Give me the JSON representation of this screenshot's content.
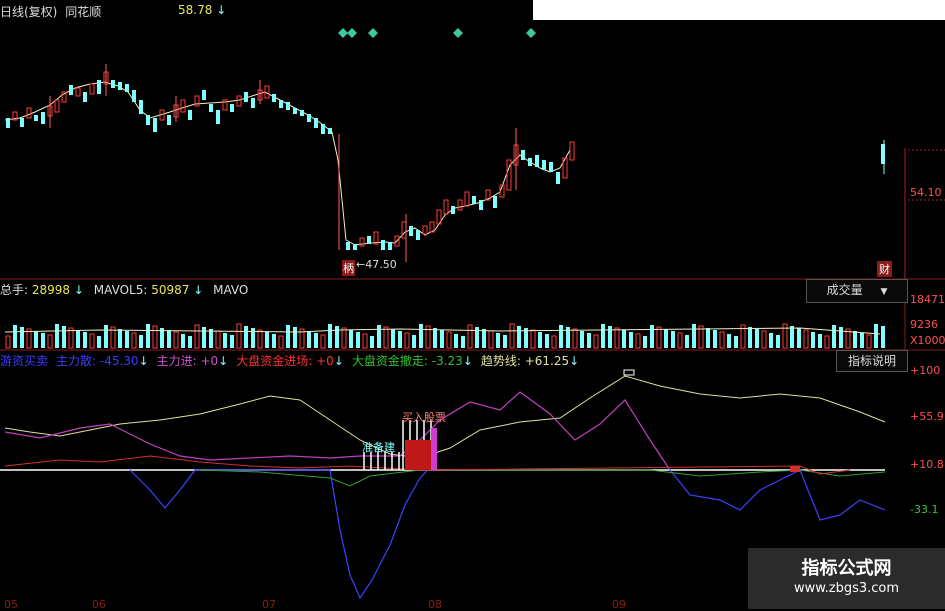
{
  "header": {
    "chart_title": "日线(复权)",
    "stock_name": "同花顺",
    "price_value": "58.78",
    "down_arrow": "↓"
  },
  "price_panel": {
    "right_label": "54.10",
    "low_marker_prefix": "柄",
    "low_marker_text": "←47.50",
    "corner_tag": "财"
  },
  "volume_panel": {
    "total_label": "总手:",
    "total_value": "28998",
    "mavol5_label": "MAVOL5:",
    "mavol5_value": "50987",
    "mavol_tail": "MAVO",
    "dropdown_label": "成交量",
    "axis": [
      "18471",
      "9236",
      "X1000"
    ]
  },
  "indicator_panel": {
    "items": [
      {
        "label": "游资买卖",
        "value": "",
        "color": "#3b3bff"
      },
      {
        "label": "主力散:",
        "value": "-45.30",
        "color": "#3b3bff"
      },
      {
        "label": "主力进:",
        "value": "+0",
        "color": "#d050d0"
      },
      {
        "label": "大盘资金进场:",
        "value": "+0",
        "color": "#ff3030"
      },
      {
        "label": "大盘资金撤走:",
        "value": "-3.23",
        "color": "#30c030"
      },
      {
        "label": "趋势线:",
        "value": "+61.25",
        "color": "#e0e0a0"
      }
    ],
    "help_button": "指标说明",
    "axis": [
      "+100",
      "+55.9",
      "+10.8",
      "-33.1"
    ],
    "annotation_prepare": "准备建",
    "annotation_buy": "买入股票"
  },
  "date_axis": [
    "05",
    "06",
    "07",
    "08",
    "09"
  ],
  "watermark": {
    "line1": "指标公式网",
    "line2": "www.zbgs3.com"
  },
  "colors": {
    "up_candle": "#ff3b3b",
    "down_candle": "#7fffff",
    "ma_line": "#f0f0c0",
    "baseline": "#ffffff"
  }
}
